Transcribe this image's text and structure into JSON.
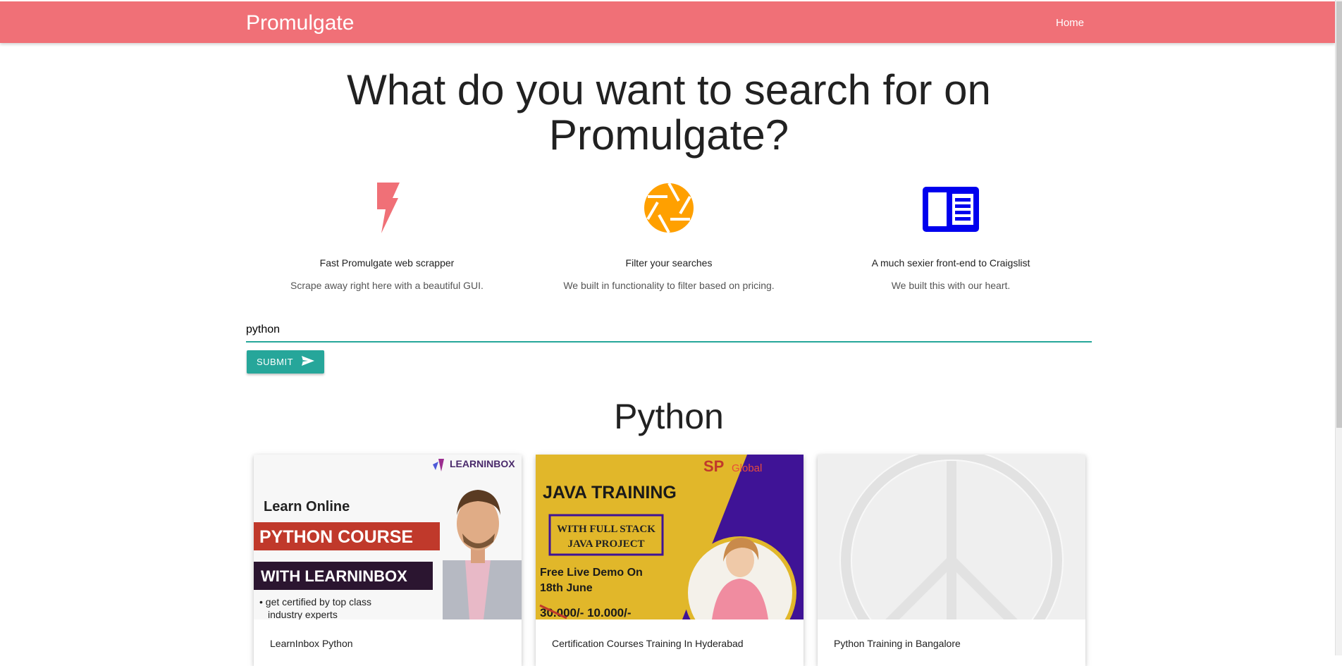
{
  "navbar": {
    "brand": "Promulgate",
    "home_link": "Home"
  },
  "hero": {
    "title": "What do you want to search for on Promulgate?"
  },
  "features": [
    {
      "icon": "lightning-icon",
      "title": "Fast Promulgate web scrapper",
      "subtitle": "Scrape away right here with a beautiful GUI.",
      "icon_color": "#f07077"
    },
    {
      "icon": "camera-aperture-icon",
      "title": "Filter your searches",
      "subtitle": "We built in functionality to filter based on pricing.",
      "icon_color": "#ffa000"
    },
    {
      "icon": "article-icon",
      "title": "A much sexier front-end to Craigslist",
      "subtitle": "We built this with our heart.",
      "icon_color": "#0000ee"
    }
  ],
  "search": {
    "value": "python",
    "submit_label": "SUBMIT"
  },
  "results": {
    "heading": "Python",
    "cards": [
      {
        "title": "LearnInbox Python",
        "image": {
          "logo": "LEARNINBOX",
          "line1": "Learn Online",
          "line2": "PYTHON COURSE",
          "line3": "WITH LEARNINBOX",
          "line4": "• get certified by top class",
          "line5": "industry experts"
        }
      },
      {
        "title": "Certification Courses Training In Hyderabad",
        "image": {
          "logo": "SP",
          "logo_suffix": "Global",
          "headline": "JAVA TRAINING",
          "box_line1": "WITH FULL STACK",
          "box_line2": "JAVA PROJECT",
          "demo_line1": "Free Live Demo On",
          "demo_line2": "18th June",
          "price": "30.000/-  10.000/-"
        }
      },
      {
        "title": "Python Training in Bangalore",
        "image": {
          "placeholder": "peace-sign-placeholder-icon"
        }
      }
    ]
  },
  "colors": {
    "primary": "#f07077",
    "accent": "#26a69a"
  }
}
